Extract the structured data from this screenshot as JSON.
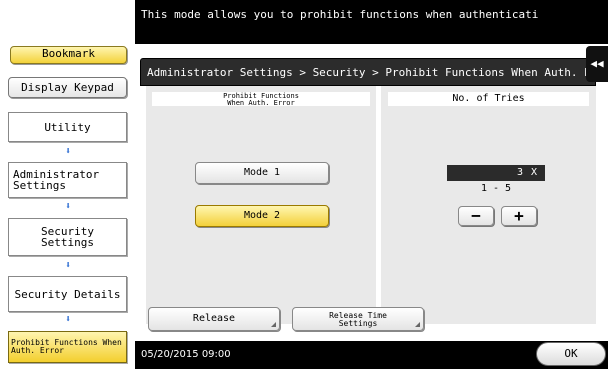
{
  "header": {
    "message": "This mode allows you to prohibit functions when authenticati"
  },
  "sidebar": {
    "bookmark_label": "Bookmark",
    "display_keypad_label": "Display Keypad",
    "nav": [
      {
        "label": "Utility"
      },
      {
        "label": "Administrator Settings"
      },
      {
        "label": "Security Settings"
      },
      {
        "label": "Security Details"
      },
      {
        "label": "Prohibit Functions When Auth. Error"
      }
    ]
  },
  "dialog": {
    "breadcrumb": "Administrator Settings > Security > Prohibit Functions When Auth. Error",
    "back_glyph": "◀◀"
  },
  "left_panel": {
    "heading": "Prohibit Functions When Auth. Error",
    "mode1_label": "Mode 1",
    "mode2_label": "Mode 2",
    "selected": "Mode 2"
  },
  "right_panel": {
    "heading": "No. of Tries",
    "value": "3",
    "unit": "X",
    "range": "1  -  5",
    "minus": "−",
    "plus": "+"
  },
  "actions": {
    "release_label": "Release",
    "release_time_label": "Release Time Settings"
  },
  "footer": {
    "datetime": "05/20/2015  09:00",
    "ok_label": "OK"
  },
  "colors": {
    "accent_yellow": "#f3d23a",
    "arrow_blue": "#2f6fd3",
    "header_bg": "#000000"
  }
}
